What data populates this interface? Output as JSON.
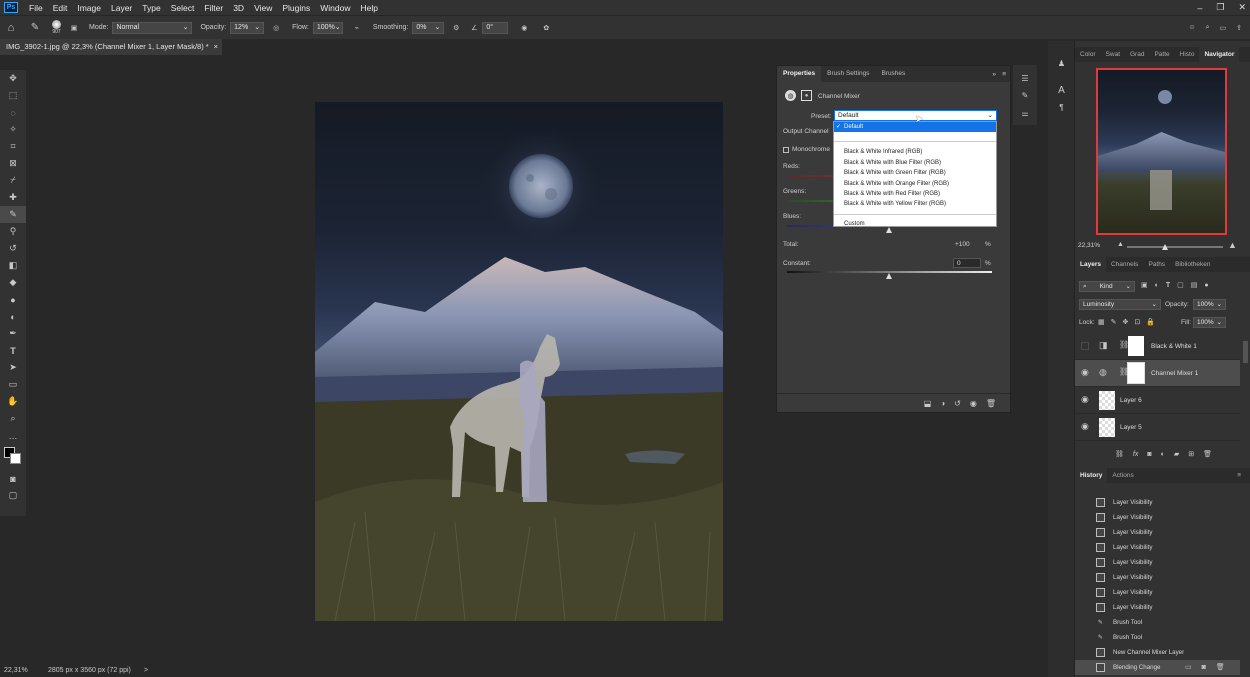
{
  "menu": {
    "logo": "Ps",
    "items": [
      "File",
      "Edit",
      "Image",
      "Layer",
      "Type",
      "Select",
      "Filter",
      "3D",
      "View",
      "Plugins",
      "Window",
      "Help"
    ]
  },
  "options": {
    "brush_size": "907",
    "mode_label": "Mode:",
    "mode_value": "Normal",
    "opacity_label": "Opacity:",
    "opacity_value": "12%",
    "flow_label": "Flow:",
    "flow_value": "100%",
    "smoothing_label": "Smoothing:",
    "smoothing_value": "0%",
    "angle_value": "0°"
  },
  "document": {
    "tab_title": "IMG_3902-1.jpg @ 22,3% (Channel Mixer 1, Layer Mask/8) *",
    "close": "×"
  },
  "status": {
    "zoom": "22,31%",
    "size": "2805 px x 3560 px (72 ppi)",
    "arrow": ">"
  },
  "properties": {
    "tabs": [
      "Properties",
      "Brush Settings",
      "Brushes"
    ],
    "adjustment_title": "Channel Mixer",
    "preset_label": "Preset:",
    "preset_value": "Default",
    "output_channel_label": "Output Channel",
    "monochrome_label": "Monochrome",
    "reds_label": "Reds:",
    "greens_label": "Greens:",
    "blues_label": "Blues:",
    "total_label": "Total:",
    "total_value": "+100",
    "total_unit": "%",
    "constant_label": "Constant:",
    "constant_value": "0",
    "constant_unit": "%"
  },
  "preset_dropdown": {
    "items": [
      "Default",
      "",
      "Black & White Infrared (RGB)",
      "Black & White with Blue Filter (RGB)",
      "Black & White with Green Filter (RGB)",
      "Black & White with Orange Filter (RGB)",
      "Black & White with Red Filter (RGB)",
      "Black & White with Yellow Filter (RGB)",
      "",
      "Custom"
    ],
    "checkmark": "✓"
  },
  "navigator": {
    "tabs": [
      "Color",
      "Swat",
      "Grad",
      "Patte",
      "Histo",
      "Navigator"
    ],
    "zoom": "22,31%"
  },
  "layers_panel": {
    "tabs": [
      "Layers",
      "Channels",
      "Paths",
      "Bibliotheken"
    ],
    "kind_label": "Kind",
    "blend_mode": "Luminosity",
    "opacity_label": "Opacity:",
    "opacity_value": "100%",
    "lock_label": "Lock:",
    "fill_label": "Fill:",
    "fill_value": "100%",
    "layers": [
      {
        "name": "Black & White 1",
        "visible": false
      },
      {
        "name": "Channel Mixer 1",
        "visible": true
      },
      {
        "name": "Layer 6",
        "visible": true
      },
      {
        "name": "Layer 5",
        "visible": true
      }
    ]
  },
  "history_panel": {
    "tabs": [
      "History",
      "Actions"
    ],
    "items": [
      "Layer Visibility",
      "Layer Visibility",
      "Layer Visibility",
      "Layer Visibility",
      "Layer Visibility",
      "Layer Visibility",
      "Layer Visibility",
      "Layer Visibility",
      "Brush Tool",
      "Brush Tool",
      "New Channel Mixer Layer",
      "Blending Change"
    ]
  }
}
